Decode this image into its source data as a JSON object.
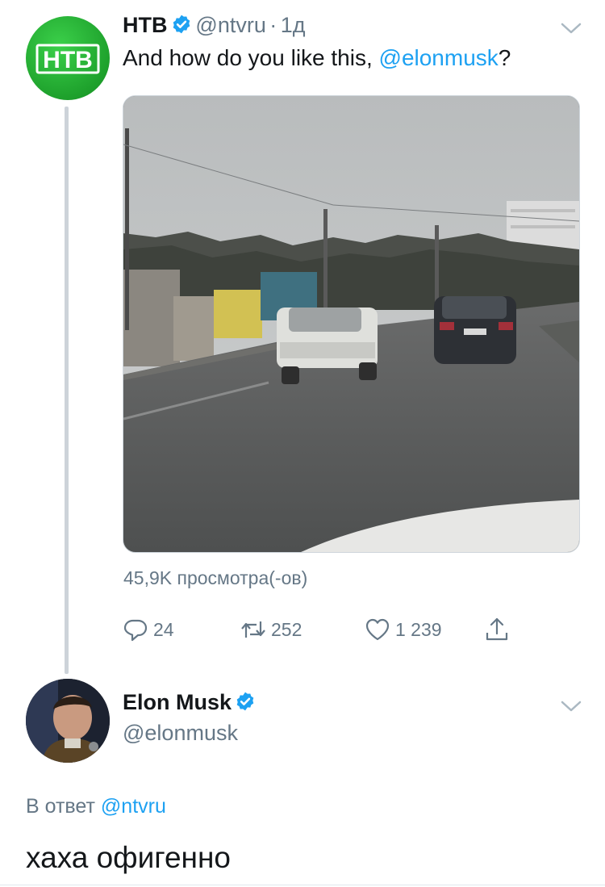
{
  "tweet": {
    "author_name": "НТВ",
    "author_handle": "@ntvru",
    "time_sep": "·",
    "time": "1д",
    "text_prefix": "And how do you like this, ",
    "text_mention": "@elonmusk",
    "text_suffix": "?",
    "logo_text": "НТВ",
    "views": "45,9K просмотра(-ов)",
    "actions": {
      "reply_count": "24",
      "retweet_count": "252",
      "like_count": "1 239"
    }
  },
  "reply": {
    "author_name": "Elon Musk",
    "author_handle": "@elonmusk",
    "reply_to_prefix": "В ответ",
    "reply_to_handle": "@ntvru",
    "text": "хаха офигенно"
  },
  "colors": {
    "accent": "#1da1f2",
    "muted": "#657786",
    "ntv_green": "#1ea12c"
  },
  "icons": [
    "verified-badge-icon",
    "chevron-down-icon",
    "reply-icon",
    "retweet-icon",
    "like-icon",
    "share-icon",
    "play-video"
  ]
}
